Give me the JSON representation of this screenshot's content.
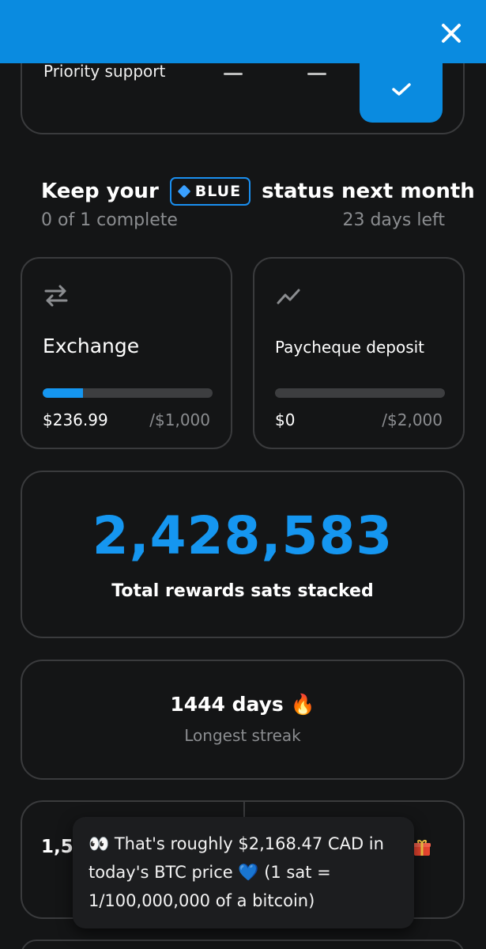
{
  "header": {
    "close_icon": "close-icon",
    "color": "#0a8be0"
  },
  "compare": {
    "row_label": "Priority support",
    "columns": [
      {
        "value": "—"
      },
      {
        "value": "—"
      },
      {
        "icon": "checkmark-icon",
        "highlight_color": "#0a8be0"
      }
    ]
  },
  "status": {
    "prefix": "Keep your",
    "badge": "BLUE",
    "suffix": "status next month",
    "progress_text": "0 of 1 complete",
    "days_left": "23 days left"
  },
  "tasks": [
    {
      "icon": "exchange-arrows-icon",
      "label": "Exchange",
      "current": "$236.99",
      "target": "/$1,000",
      "progress": 0.237
    },
    {
      "icon": "trend-line-icon",
      "label": "Paycheque deposit",
      "current": "$0",
      "target": "/$2,000",
      "progress": 0
    }
  ],
  "rewards": {
    "value": "2,428,583",
    "label": "Total rewards sats stacked",
    "color": "#1596f0"
  },
  "streak": {
    "value": "1444 days",
    "emoji": "🔥",
    "label": "Longest streak"
  },
  "bottom": {
    "left_value": "1,5",
    "gift_icon": "gift-icon"
  },
  "tooltip": {
    "text": "👀 That's roughly $2,168.47 CAD in today's BTC price 💙 (1 sat = 1/100,000,000 of a bitcoin)"
  }
}
